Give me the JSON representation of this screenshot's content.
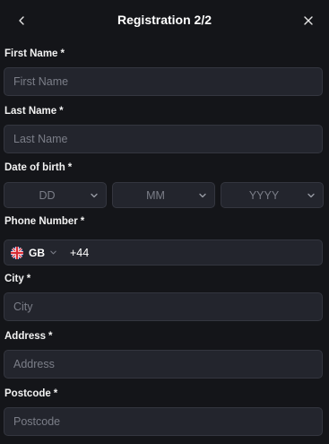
{
  "header": {
    "title": "Registration 2/2"
  },
  "form": {
    "first_name": {
      "label": "First Name",
      "required": "*",
      "placeholder": "First Name"
    },
    "last_name": {
      "label": "Last Name",
      "required": "*",
      "placeholder": "Last Name"
    },
    "dob": {
      "label": "Date of birth",
      "required": "*",
      "day": "DD",
      "month": "MM",
      "year": "YYYY"
    },
    "phone": {
      "label": "Phone Number",
      "required": "*",
      "country": "GB",
      "dial_code": "+44",
      "value": ""
    },
    "city": {
      "label": "City",
      "required": "*",
      "placeholder": "City"
    },
    "address": {
      "label": "Address",
      "required": "*",
      "placeholder": "Address"
    },
    "postcode": {
      "label": "Postcode",
      "required": "*",
      "placeholder": "Postcode"
    }
  },
  "icons": {
    "back": "chevron-left-icon",
    "close": "close-icon",
    "dropdown": "chevron-down-icon",
    "flag": "uk-flag-icon"
  },
  "colors": {
    "background": "#141519",
    "field_background": "#23252d",
    "field_border": "#34363f",
    "placeholder": "#7b7e88",
    "text": "#ffffff"
  }
}
